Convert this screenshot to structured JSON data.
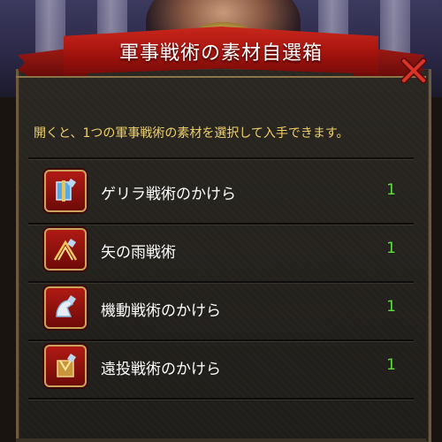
{
  "dialog": {
    "title": "軍事戦術の素材自選箱",
    "description": "開くと、1つの軍事戦術の素材を選択して入手できます。"
  },
  "colors": {
    "banner": "#b01a14",
    "description_text": "#f1d166",
    "quantity_text": "#5be03a"
  },
  "items": [
    {
      "name": "ゲリラ戦術のかけら",
      "quantity": "1",
      "icon": "guerrilla-tactic-fragment-icon"
    },
    {
      "name": "矢の雨戦術",
      "quantity": "1",
      "icon": "arrow-rain-tactic-icon"
    },
    {
      "name": "機動戦術のかけら",
      "quantity": "1",
      "icon": "mobile-tactic-fragment-icon"
    },
    {
      "name": "遠投戦術のかけら",
      "quantity": "1",
      "icon": "long-throw-tactic-fragment-icon"
    }
  ]
}
